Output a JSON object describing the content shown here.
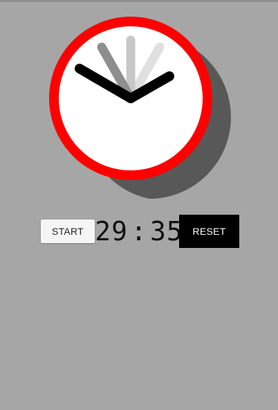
{
  "clock": {
    "rim_color": "#ff0000",
    "face_color": "#ffffff",
    "hand_color": "#000000",
    "trail_colors": [
      "#e0e0e0",
      "#c8c8c8",
      "#8e8e8e"
    ]
  },
  "controls": {
    "start_label": "START",
    "timer_minutes": "29",
    "timer_separator": ":",
    "timer_seconds": "35",
    "reset_label": "RESET"
  }
}
